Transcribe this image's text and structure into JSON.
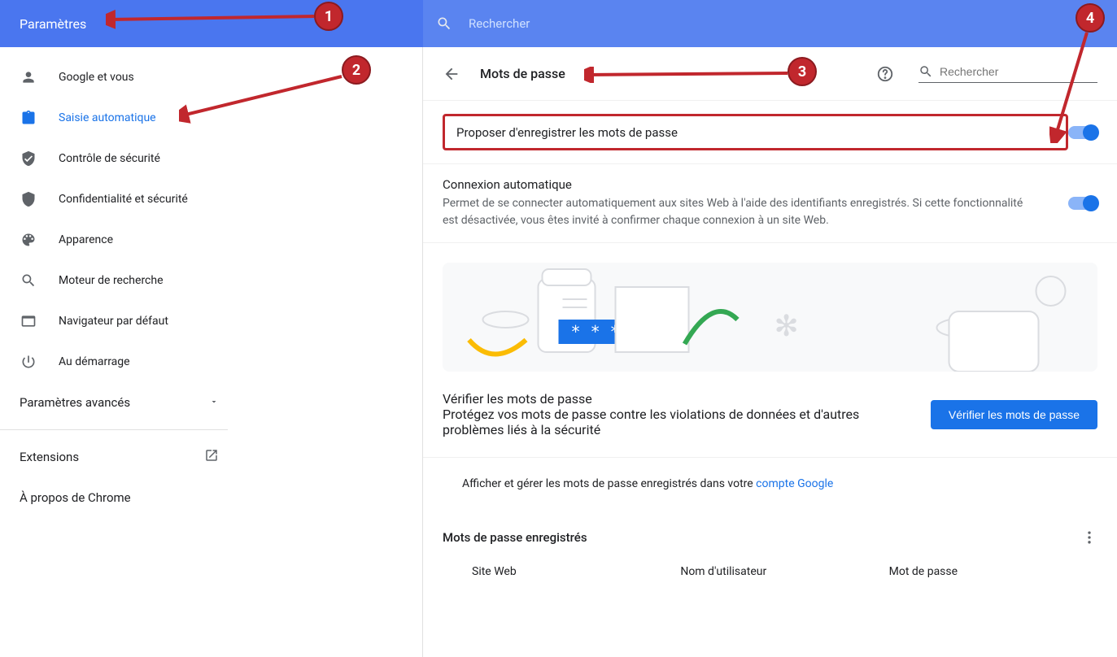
{
  "header": {
    "title": "Paramètres",
    "search_placeholder": "Rechercher"
  },
  "sidebar": {
    "items": [
      {
        "label": "Google et vous"
      },
      {
        "label": "Saisie automatique"
      },
      {
        "label": "Contrôle de sécurité"
      },
      {
        "label": "Confidentialité et sécurité"
      },
      {
        "label": "Apparence"
      },
      {
        "label": "Moteur de recherche"
      },
      {
        "label": "Navigateur par défaut"
      },
      {
        "label": "Au démarrage"
      }
    ],
    "advanced_label": "Paramètres avancés",
    "extensions_label": "Extensions",
    "about_label": "À propos de Chrome"
  },
  "main": {
    "title": "Mots de passe",
    "search_placeholder": "Rechercher",
    "offer_save_label": "Proposer d'enregistrer les mots de passe",
    "auto_signin_label": "Connexion automatique",
    "auto_signin_desc": "Permet de se connecter automatiquement aux sites Web à l'aide des identifiants enregistrés. Si cette fonctionnalité est désactivée, vous êtes invité à confirmer chaque connexion à un site Web.",
    "check_title": "Vérifier les mots de passe",
    "check_desc": "Protégez vos mots de passe contre les violations de données et d'autres problèmes liés à la sécurité",
    "check_button": "Vérifier les mots de passe",
    "google_account_text": "Afficher et gérer les mots de passe enregistrés dans votre ",
    "google_account_link": "compte Google",
    "saved_passwords_label": "Mots de passe enregistrés",
    "table_headers": {
      "site": "Site Web",
      "username": "Nom d'utilisateur",
      "password": "Mot de passe"
    }
  },
  "markers": [
    "1",
    "2",
    "3",
    "4"
  ]
}
